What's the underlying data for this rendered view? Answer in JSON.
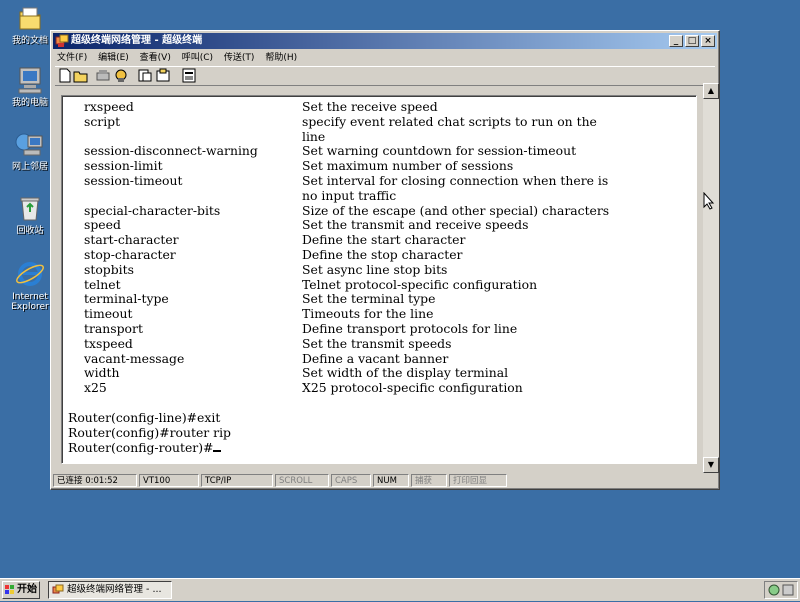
{
  "desktop": {
    "icons": [
      {
        "label": "我的文档",
        "icon": "my-documents-icon"
      },
      {
        "label": "我的电脑",
        "icon": "my-computer-icon"
      },
      {
        "label": "网上邻居",
        "icon": "network-places-icon"
      },
      {
        "label": "回收站",
        "icon": "recycle-bin-icon"
      },
      {
        "label": "Internet Explorer",
        "icon": "internet-explorer-icon"
      }
    ]
  },
  "window": {
    "title": "超级终端网络管理 - 超级终端",
    "controls": {
      "minimize": "_",
      "maximize": "□",
      "close": "×"
    },
    "menu": [
      "文件(F)",
      "编辑(E)",
      "查看(V)",
      "呼叫(C)",
      "传送(T)",
      "帮助(H)"
    ],
    "toolbar": [
      "new-icon",
      "open-icon",
      "disconnect-icon",
      "call-icon",
      "send-icon",
      "receive-icon",
      "properties-icon"
    ]
  },
  "terminal": {
    "commands": [
      {
        "name": "rxspeed",
        "desc": "Set the receive speed"
      },
      {
        "name": "script",
        "desc": "specify event related chat scripts to run on the"
      },
      {
        "name": "",
        "desc": "line"
      },
      {
        "name": "session-disconnect-warning",
        "desc": "Set warning countdown for session-timeout"
      },
      {
        "name": "session-limit",
        "desc": "Set maximum number of sessions"
      },
      {
        "name": "session-timeout",
        "desc": "Set interval for closing connection when there is"
      },
      {
        "name": "",
        "desc": "no input traffic"
      },
      {
        "name": "special-character-bits",
        "desc": "Size of the escape (and other special) characters"
      },
      {
        "name": "speed",
        "desc": "Set the transmit and receive speeds"
      },
      {
        "name": "start-character",
        "desc": "Define the start character"
      },
      {
        "name": "stop-character",
        "desc": "Define the stop character"
      },
      {
        "name": "stopbits",
        "desc": "Set async line stop bits"
      },
      {
        "name": "telnet",
        "desc": "Telnet protocol-specific configuration"
      },
      {
        "name": "terminal-type",
        "desc": "Set the terminal type"
      },
      {
        "name": "timeout",
        "desc": "Timeouts for the line"
      },
      {
        "name": "transport",
        "desc": "Define transport protocols for line"
      },
      {
        "name": "txspeed",
        "desc": "Set the transmit speeds"
      },
      {
        "name": "vacant-message",
        "desc": "Define a vacant banner"
      },
      {
        "name": "width",
        "desc": "Set width of the display terminal"
      },
      {
        "name": "x25",
        "desc": "X25 protocol-specific configuration"
      }
    ],
    "prompts": [
      "Router(config-line)#exit",
      "Router(config)#router rip",
      "Router(config-router)#"
    ]
  },
  "statusbar": {
    "connected": "已连接 0:01:52",
    "emulation": "VT100",
    "protocol": "TCP/IP",
    "scroll": "SCROLL",
    "caps": "CAPS",
    "num": "NUM",
    "capture": "捕获",
    "echo": "打印回显"
  },
  "taskbar": {
    "start": "开始",
    "task": "超级终端网络管理 - ..."
  }
}
